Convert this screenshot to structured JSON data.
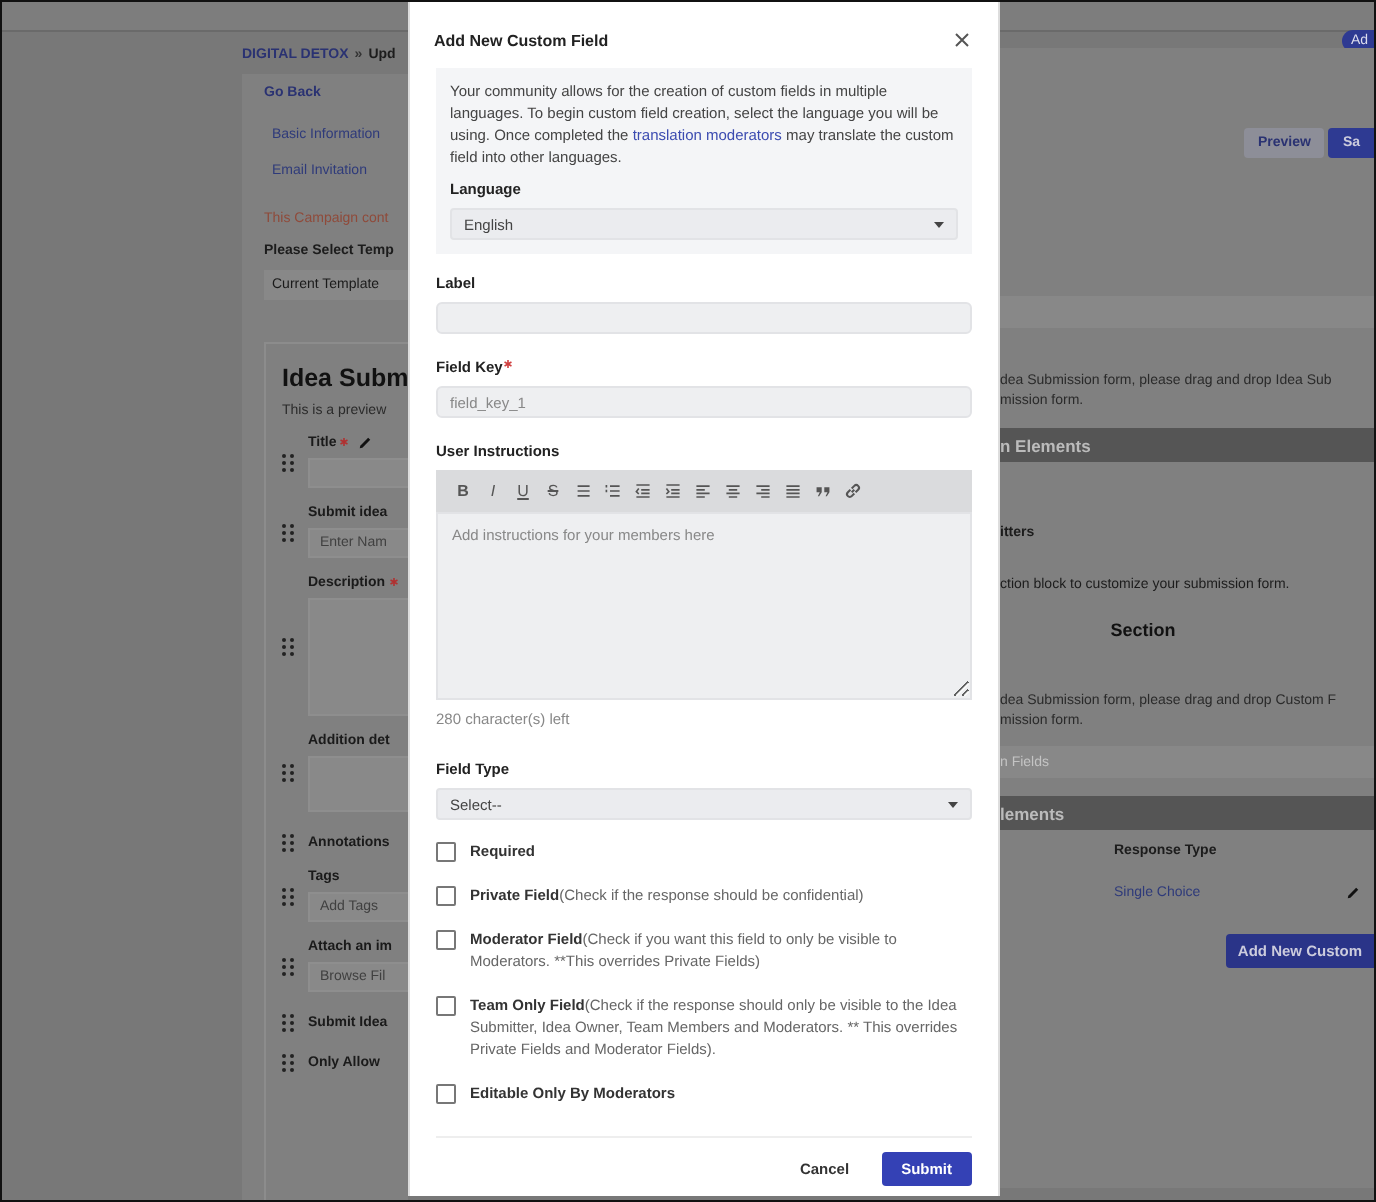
{
  "page": {
    "breadcrumb": {
      "link": "DIGITAL DETOX",
      "separator": "»",
      "current": "Upd"
    },
    "go_back": "Go Back",
    "nav": [
      "Basic Information",
      "Email Invitation"
    ],
    "notice": "This Campaign cont",
    "template": {
      "label": "Please Select Temp",
      "value": "Current Template"
    },
    "preview": {
      "title": "Idea Subm",
      "subtitle": "This is a preview",
      "fields": [
        {
          "kind": "input",
          "label": "Title",
          "required": true,
          "editable": true
        },
        {
          "kind": "input",
          "label": "Submit idea",
          "required": false,
          "editable": false,
          "placeholder": "Enter Nam"
        },
        {
          "kind": "textarea",
          "label": "Description",
          "required": true,
          "editable": false
        },
        {
          "kind": "box",
          "label": "Addition det",
          "required": false,
          "editable": false
        },
        {
          "kind": "label",
          "label": "Annotations",
          "required": false,
          "editable": false
        },
        {
          "kind": "input",
          "label": "Tags",
          "required": false,
          "editable": false,
          "placeholder": "Add Tags"
        },
        {
          "kind": "input",
          "label": "Attach an im",
          "required": false,
          "editable": false,
          "placeholder": "Browse Fil"
        },
        {
          "kind": "label",
          "label": "Submit Idea",
          "required": false,
          "editable": false
        },
        {
          "kind": "label",
          "label": "Only Allow",
          "required": false,
          "editable": false
        }
      ]
    },
    "right": {
      "add_pill": "Ad",
      "preview_button": "Preview",
      "save_button": "Sa",
      "hint_1": [
        "dea Submission form, please drag and drop Idea Sub",
        "mission form."
      ],
      "band_1": "n Elements",
      "row_title": "itters",
      "hint_2": "ction block to customize your submission form.",
      "section_title": "Section",
      "hint_3": [
        "dea Submission form, please drag and drop Custom F",
        "mission form."
      ],
      "field_band": "n Fields",
      "band_2": "lements",
      "column_header": "Response Type",
      "response_value": "Single Choice",
      "add_button": "Add New Custom"
    }
  },
  "dialog": {
    "title": "Add New Custom Field",
    "intro": {
      "before": "Your community allows for the creation of custom fields in multiple languages. To begin custom field creation, select the language you will be using. Once completed the ",
      "link": "translation moderators",
      "after": " may translate the custom field into other languages."
    },
    "language": {
      "label": "Language",
      "value": "English"
    },
    "label_field": {
      "label": "Label"
    },
    "field_key": {
      "label": "Field Key",
      "required": true,
      "placeholder": "field_key_1"
    },
    "instructions": {
      "label": "User Instructions",
      "placeholder": "Add instructions for your members here",
      "counter": "280 character(s) left",
      "toolbar": [
        {
          "kind": "bold",
          "label": "B"
        },
        {
          "kind": "italic",
          "label": "I"
        },
        {
          "kind": "underline",
          "label": "U"
        },
        {
          "kind": "strike",
          "label": "S"
        },
        {
          "kind": "bullets"
        },
        {
          "kind": "numbers"
        },
        {
          "kind": "outdent"
        },
        {
          "kind": "indent"
        },
        {
          "kind": "align-left"
        },
        {
          "kind": "align-center"
        },
        {
          "kind": "align-right"
        },
        {
          "kind": "justify"
        },
        {
          "kind": "quote"
        },
        {
          "kind": "link"
        }
      ]
    },
    "field_type": {
      "label": "Field Type",
      "value": "Select--"
    },
    "options": [
      {
        "title": "Required",
        "checked": false
      },
      {
        "title": "Private Field",
        "note": "(Check if the response should be confidential)",
        "checked": false
      },
      {
        "title": "Moderator Field",
        "note": "(Check if you want this field to only be visible to Moderators. **This overrides Private Fields)",
        "checked": false
      },
      {
        "title": "Team Only Field",
        "note": "(Check if the response should only be visible to the Idea Submitter, Idea Owner, Team Members and Moderators. ** This overrides Private Fields and Moderator Fields).",
        "checked": false
      },
      {
        "title": "Editable Only By Moderators",
        "checked": false
      }
    ],
    "cancel": "Cancel",
    "submit": "Submit"
  }
}
